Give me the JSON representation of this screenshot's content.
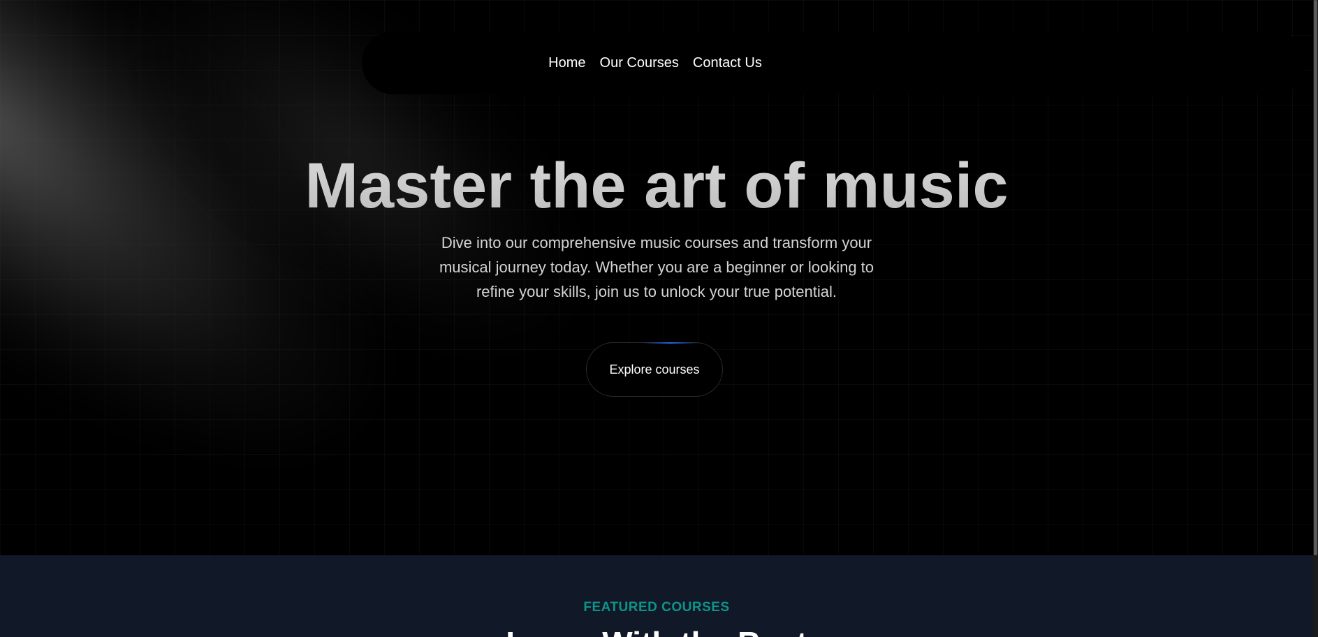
{
  "nav": {
    "links": [
      "Home",
      "Our Courses",
      "Contact Us"
    ]
  },
  "hero": {
    "title": "Master the art of music",
    "description": "Dive into our comprehensive music courses and transform your musical journey today. Whether you are a beginner or looking to refine your skills, join us to unlock your true potential.",
    "cta_label": "Explore courses"
  },
  "featured": {
    "eyebrow": "FEATURED COURSES",
    "title": "Learn With the Best"
  },
  "colors": {
    "page_background": "#000000",
    "section_background": "#111827",
    "accent_teal": "#0d9488",
    "button_glow_blue": "#2563eb"
  }
}
